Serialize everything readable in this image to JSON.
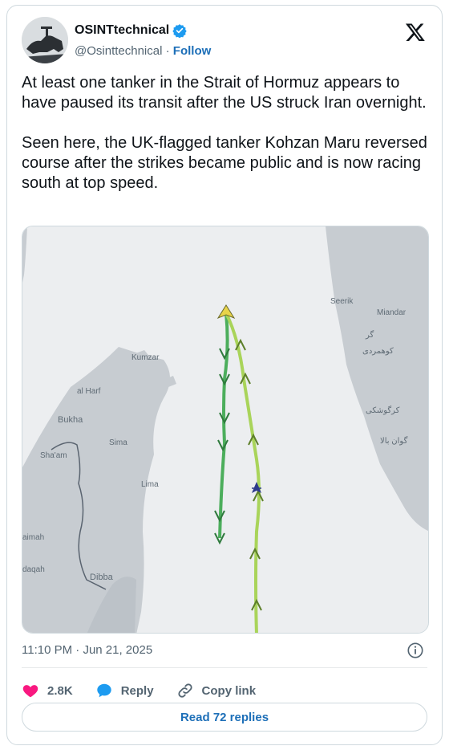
{
  "header": {
    "display_name": "OSINTtechnical",
    "handle": "@Osinttechnical",
    "separator": "·",
    "follow_label": "Follow"
  },
  "tweet": {
    "paragraph_1": "At least one tanker in the Strait of Hormuz appears to have paused its transit after the US struck Iran overnight.",
    "paragraph_2": "Seen here, the UK-flagged tanker Kohzan Maru reversed course after the strikes became public and is now racing south at top speed."
  },
  "map": {
    "place_names": {
      "seerik": "Seerik",
      "miandar": "Miandar",
      "gar": "گر",
      "kuhmardi": "کوهمردی",
      "kumzar": "Kumzar",
      "al_harf": "al Harf",
      "bukha": "Bukha",
      "sima": "Sima",
      "shaam": "Sha'am",
      "lima": "Lima",
      "kargushki": "کرگوشکی",
      "gavan_bala": "گوان بالا",
      "aimah": "aimah",
      "daqah": "daqah",
      "dibba": "Dibba"
    },
    "colors": {
      "water": "#eceef0",
      "land": "#c7ccd1",
      "track_south": "#4cae5c",
      "track_north": "#a9d45a",
      "border": "#5a6470"
    }
  },
  "meta": {
    "time": "11:10 PM",
    "separator": "·",
    "date": "Jun 21, 2025"
  },
  "actions": {
    "likes": "2.8K",
    "reply_label": "Reply",
    "copy_link_label": "Copy link",
    "read_replies_label": "Read 72 replies"
  }
}
